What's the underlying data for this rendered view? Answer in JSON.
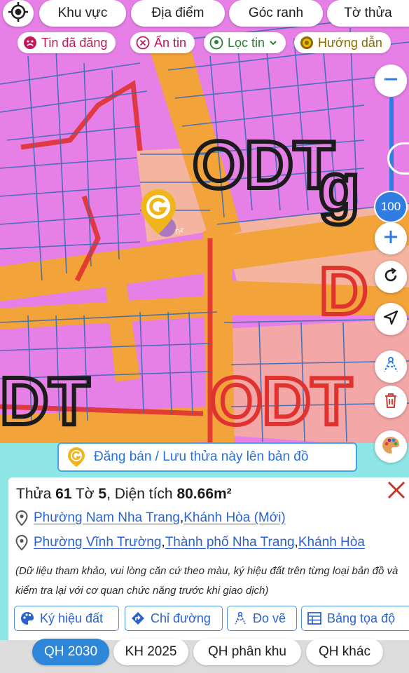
{
  "top_tabs": [
    {
      "label": "Khu vực"
    },
    {
      "label": "Địa điểm"
    },
    {
      "label": "Góc ranh"
    },
    {
      "label": "Tờ thửa"
    }
  ],
  "chips": [
    {
      "label": "Tin đã đăng",
      "icon": "sad-face-icon",
      "color": "#c2185b"
    },
    {
      "label": "Ẩn tin",
      "icon": "close-circle-icon",
      "color": "#c2185b"
    },
    {
      "label": "Lọc tin",
      "icon": "location-pin-icon",
      "color": "#2e7d32"
    },
    {
      "label": "Hướng dẫn",
      "icon": "play-circle-icon",
      "color": "#8a6d00"
    }
  ],
  "map": {
    "zoom_level": "100",
    "zone_labels": [
      "ODT",
      "ODT",
      "ODT",
      "DT",
      "D"
    ],
    "area_fragment": "n²"
  },
  "post_banner": {
    "label": "Đăng bán / Lưu thửa này lên bản đồ"
  },
  "parcel": {
    "prefix_thua": "Thửa",
    "thua": "61",
    "prefix_to": "Tờ",
    "to": "5",
    "prefix_area": ", Diện tích",
    "area": "80.66m²",
    "new_address": {
      "ward": "Phường Nam Nha Trang",
      "province": "Khánh Hòa (Mới)"
    },
    "old_address": {
      "ward": "Phường Vĩnh Trường",
      "city": "Thành phố Nha Trang",
      "province": "Khánh Hòa"
    },
    "note": "(Dữ liệu tham khảo, vui lòng căn cứ theo màu, ký hiệu đất trên từng loại bản đồ và kiểm tra lại với cơ quan chức năng trước khi giao dịch)"
  },
  "actions": [
    {
      "label": "Ký hiệu đất",
      "icon": "palette-icon"
    },
    {
      "label": "Chỉ đường",
      "icon": "directions-icon"
    },
    {
      "label": "Đo vẽ",
      "icon": "measure-icon"
    },
    {
      "label": "Bảng tọa độ",
      "icon": "table-icon"
    }
  ],
  "bottom_tabs": [
    {
      "label": "QH 2030",
      "active": true
    },
    {
      "label": "KH 2025",
      "active": false
    },
    {
      "label": "QH phân khu",
      "active": false
    },
    {
      "label": "QH khác",
      "active": false
    }
  ],
  "colors": {
    "residential": "#e67fe6",
    "road": "#f2a33a",
    "public_land": "#f5b4a0",
    "parcel_line": "#3a6db8",
    "accent_blue": "#2e86d9",
    "close_red": "#c0392b"
  }
}
